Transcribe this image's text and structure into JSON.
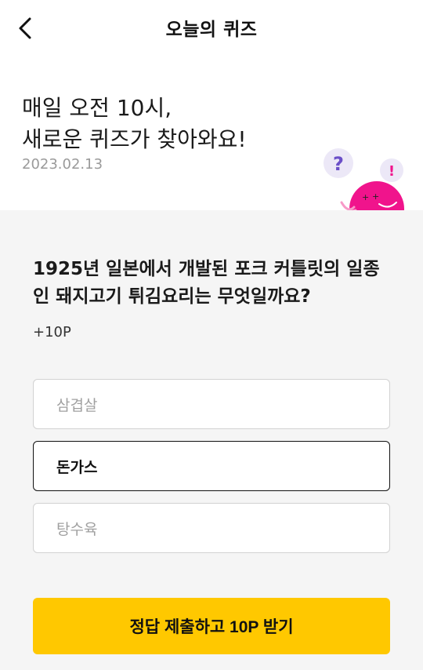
{
  "header": {
    "title": "오늘의 퀴즈",
    "back_icon": "chevron-left-icon"
  },
  "hero": {
    "line1": "매일 오전 10시,",
    "line2": "새로운 퀴즈가 찾아와요!",
    "date": "2023.02.13",
    "mascot_marks": {
      "question": "?",
      "exclaim": "!"
    }
  },
  "quiz": {
    "question": "1925년 일본에서 개발된 포크 커틀릿의 일종인 돼지고기 튀김요리는 무엇일까요?",
    "points": "+10P",
    "options": [
      {
        "label": "삼겹살",
        "selected": false
      },
      {
        "label": "돈가스",
        "selected": true
      },
      {
        "label": "탕수육",
        "selected": false
      }
    ]
  },
  "submit": {
    "label": "정답 제출하고 10P 받기"
  },
  "colors": {
    "accent": "#ffc800",
    "mascot": "#f0148c",
    "bubble": "#ece8f7",
    "question_mark": "#6b4fc8"
  }
}
